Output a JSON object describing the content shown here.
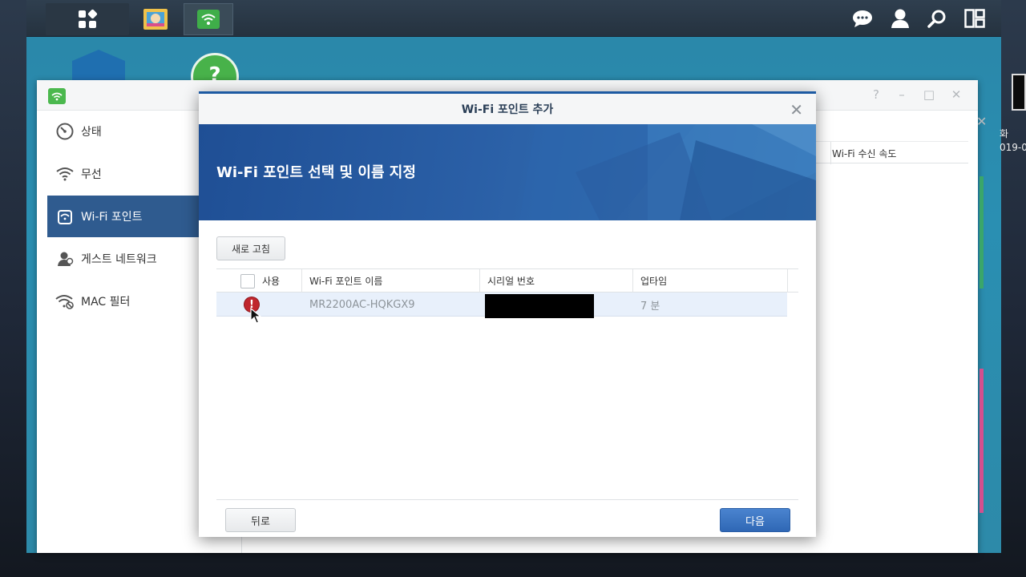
{
  "colors": {
    "accent": "#2f5b8f",
    "modal_border": "#1d5aa2",
    "warning": "#c0262d",
    "next_button": "#3a72c0"
  },
  "taskbar": {
    "icons": [
      "main-menu-icon",
      "photo-app-icon",
      "wifi-app-icon",
      "chat-icon",
      "user-icon",
      "search-icon",
      "widgets-icon"
    ]
  },
  "desktop": {
    "right_label_1": "화",
    "right_label_2": "019-0"
  },
  "app": {
    "sidebar": {
      "items": [
        {
          "label": "상태",
          "icon": "speedometer-icon"
        },
        {
          "label": "무선",
          "icon": "wifi-icon"
        },
        {
          "label": "Wi-Fi 포인트",
          "icon": "router-icon"
        },
        {
          "label": "게스트 네트워크",
          "icon": "guest-icon"
        },
        {
          "label": "MAC 필터",
          "icon": "wifi-filter-icon"
        }
      ]
    },
    "bg_column": "Wi-Fi 수신 속도",
    "window_controls": {
      "help": "?",
      "minimize": "–",
      "maximize": "□",
      "close": "✕"
    }
  },
  "modal": {
    "title": "Wi-Fi 포인트 추가",
    "close": "✕",
    "banner_title": "Wi-Fi 포인트 선택 및 이름 지정",
    "refresh_label": "새로 고침",
    "columns": {
      "enable": "사용",
      "name": "Wi-Fi 포인트 이름",
      "serial": "시리얼 번호",
      "uptime": "업타임"
    },
    "rows": [
      {
        "status": "!",
        "name": "MR2200AC-HQKGX9",
        "uptime": "7 분"
      }
    ],
    "back_label": "뒤로",
    "next_label": "다음"
  }
}
